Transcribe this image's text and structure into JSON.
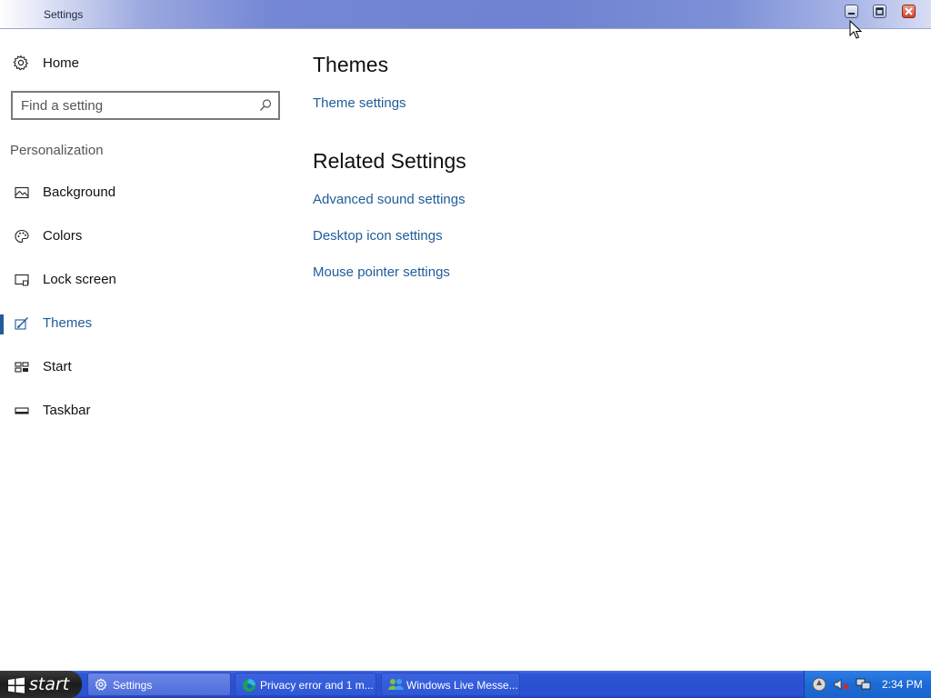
{
  "window": {
    "title": "Settings"
  },
  "sidebar": {
    "home_label": "Home",
    "search_placeholder": "Find a setting",
    "section_label": "Personalization",
    "items": [
      {
        "label": "Background",
        "icon": "picture-icon"
      },
      {
        "label": "Colors",
        "icon": "palette-icon"
      },
      {
        "label": "Lock screen",
        "icon": "lock-screen-icon"
      },
      {
        "label": "Themes",
        "icon": "themes-brush-icon",
        "active": true
      },
      {
        "label": "Start",
        "icon": "start-tiles-icon"
      },
      {
        "label": "Taskbar",
        "icon": "taskbar-icon"
      }
    ]
  },
  "main": {
    "themes_heading": "Themes",
    "theme_settings_link": "Theme settings",
    "related_heading": "Related Settings",
    "related_links": [
      "Advanced sound settings",
      "Desktop icon settings",
      "Mouse pointer settings"
    ]
  },
  "taskbar": {
    "start_label": "start",
    "tasks": [
      {
        "label": "Settings",
        "icon": "gear-icon",
        "active": true
      },
      {
        "label": "Privacy error and 1 m...",
        "icon": "edge-browser-icon"
      },
      {
        "label": "Windows Live Messe...",
        "icon": "messenger-icon"
      }
    ],
    "clock": "2:34 PM"
  },
  "colors": {
    "accent": "#1f5c9a",
    "taskbar": "#2850d0"
  }
}
